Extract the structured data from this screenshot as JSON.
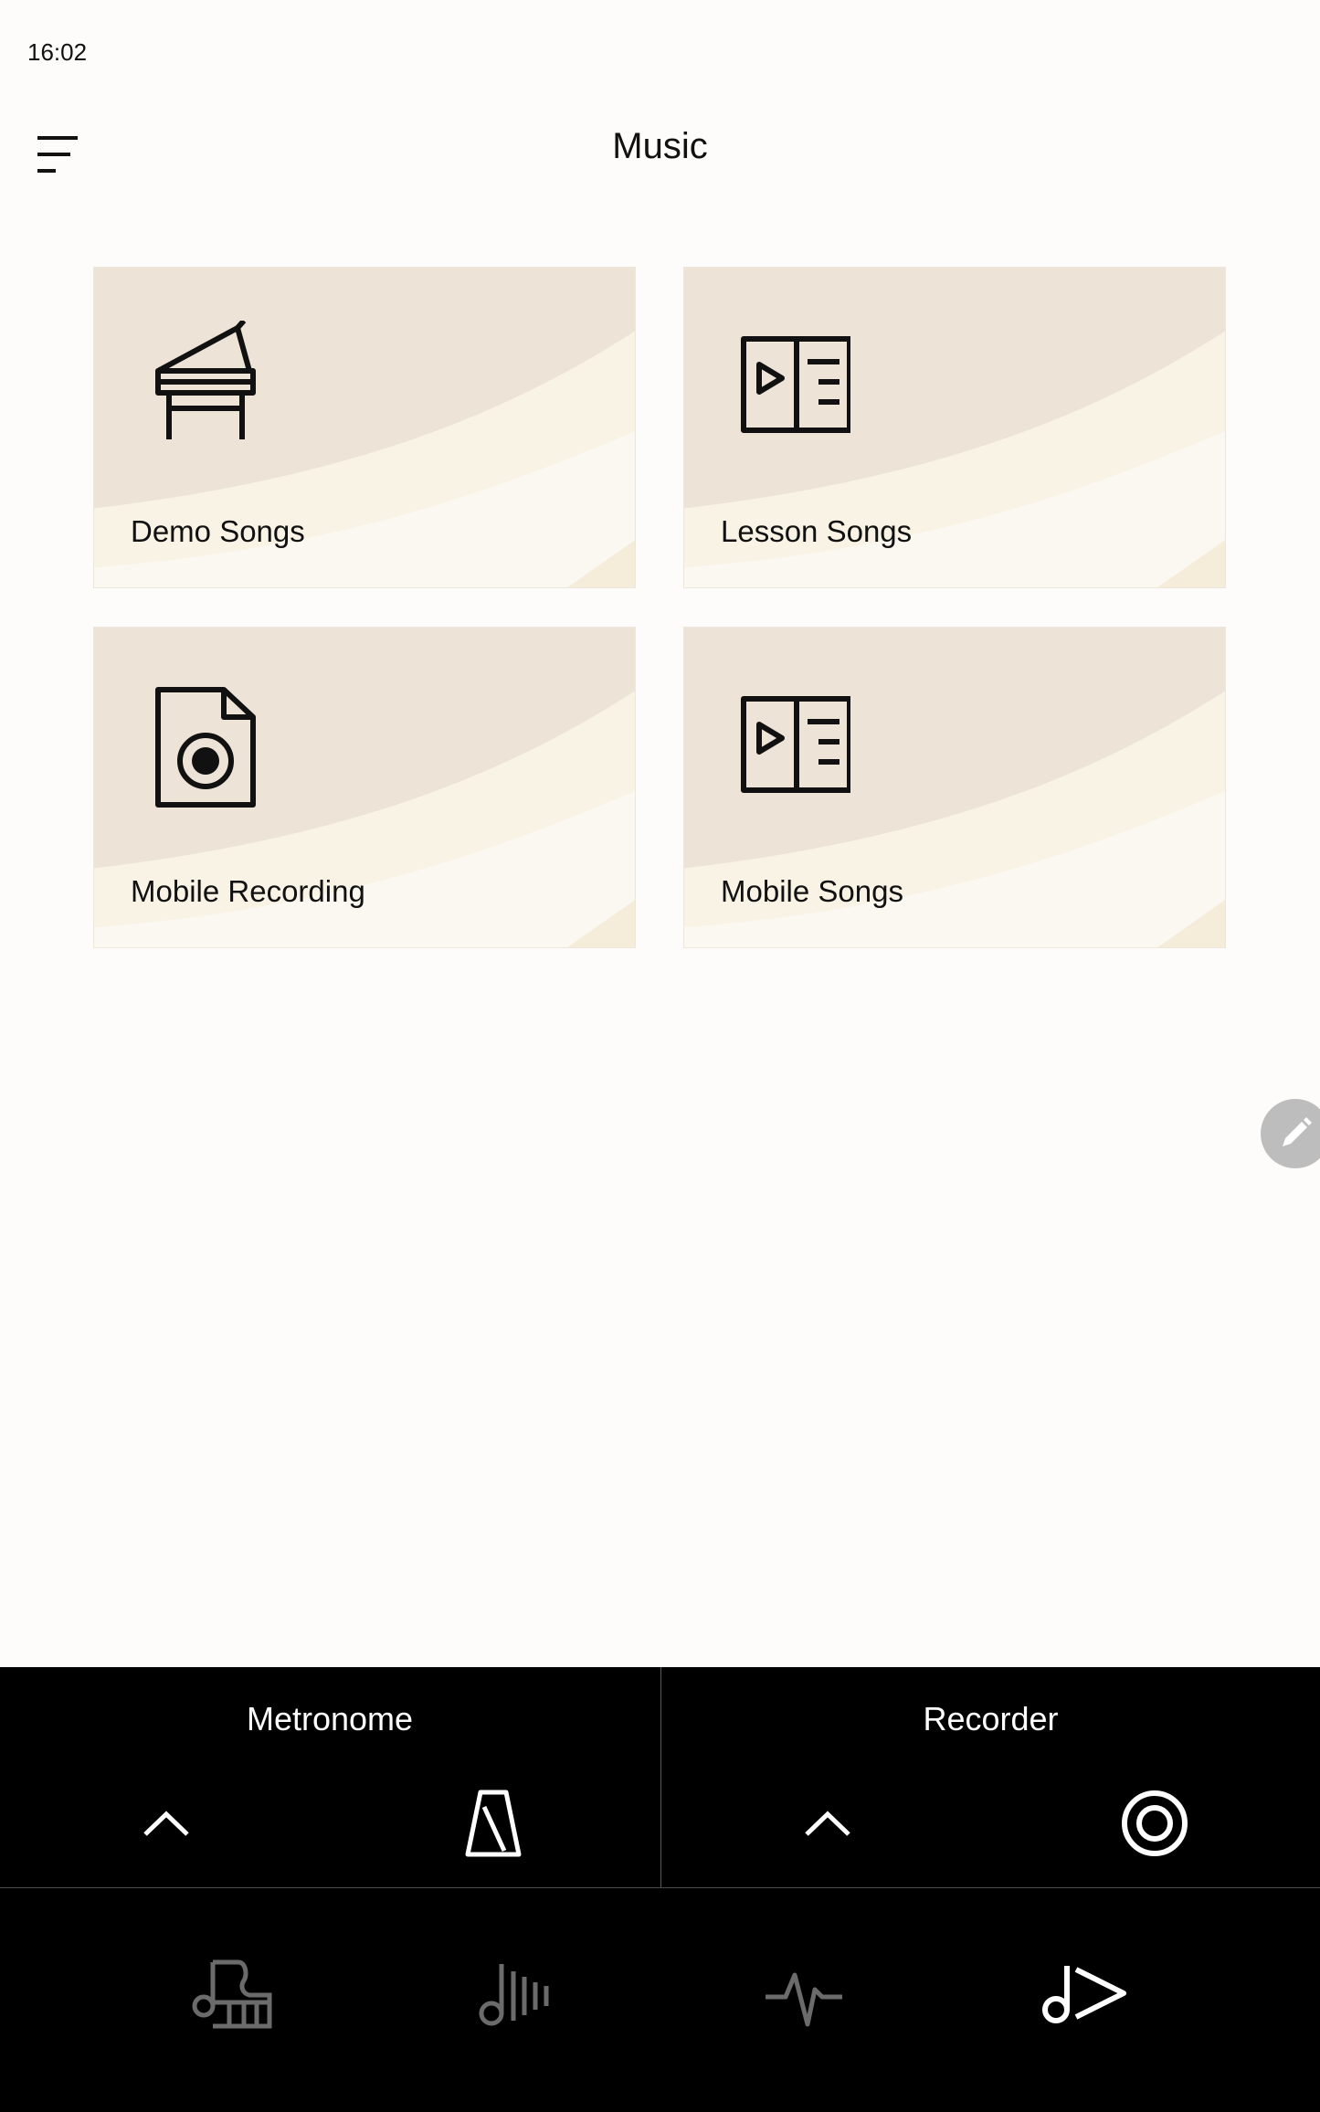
{
  "status_bar": {
    "time": "16:02"
  },
  "header": {
    "title": "Music",
    "menu_icon": "menu-icon"
  },
  "tiles": [
    {
      "label": "Demo Songs",
      "icon": "grand-piano-icon"
    },
    {
      "label": "Lesson Songs",
      "icon": "song-book-icon"
    },
    {
      "label": "Mobile Recording",
      "icon": "audio-file-icon"
    },
    {
      "label": "Mobile Songs",
      "icon": "song-book-icon"
    }
  ],
  "edit_button": {
    "icon": "pencil-icon"
  },
  "tool_panel": {
    "metronome": {
      "title": "Metronome",
      "expand_icon": "chevron-up-icon",
      "action_icon": "metronome-icon"
    },
    "recorder": {
      "title": "Recorder",
      "expand_icon": "chevron-up-icon",
      "action_icon": "record-icon"
    }
  },
  "bottom_nav": [
    {
      "icon": "piano-note-icon",
      "active": false
    },
    {
      "icon": "voice-list-icon",
      "active": false
    },
    {
      "icon": "waveform-icon",
      "active": false
    },
    {
      "icon": "music-play-icon",
      "active": true
    }
  ],
  "colors": {
    "background": "#fdfcfa",
    "tile_light": "#fbf8f1",
    "tile_dark": "#ede3d7",
    "panel": "#000000",
    "nav_inactive": "#6b6b6b",
    "nav_active": "#ffffff"
  }
}
